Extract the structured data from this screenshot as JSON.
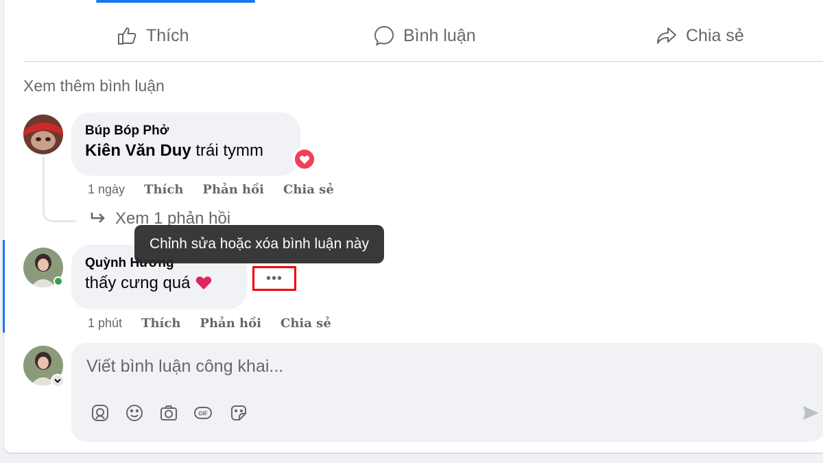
{
  "actions": {
    "like": "Thích",
    "comment": "Bình luận",
    "share": "Chia sẻ"
  },
  "more_comments": "Xem thêm bình luận",
  "comments": [
    {
      "author": "Búp Bóp Phở",
      "mention": "Kiên Văn Duy",
      "text": " trái tymm",
      "time": "1 ngày",
      "like": "Thích",
      "reply": "Phản hồi",
      "share": "Chia sẻ",
      "reaction_icon": "love-reaction-icon",
      "replies_link": "Xem 1 phản hồi"
    },
    {
      "author": "Quỳnh Hương",
      "text": "thấy cưng quá",
      "time": "1 phút",
      "like": "Thích",
      "reply": "Phản hồi",
      "share": "Chia sẻ",
      "emoji": "red-heart-emoji"
    }
  ],
  "tooltip": "Chỉnh sửa hoặc xóa bình luận này",
  "more_button": "•••",
  "composer": {
    "placeholder": "Viết bình luận công khai..."
  },
  "colors": {
    "accent": "#1877f2",
    "muted_text": "#65676b",
    "bubble_bg": "#f0f2f5",
    "highlight_border": "#ee0000",
    "online": "#31a24c"
  }
}
